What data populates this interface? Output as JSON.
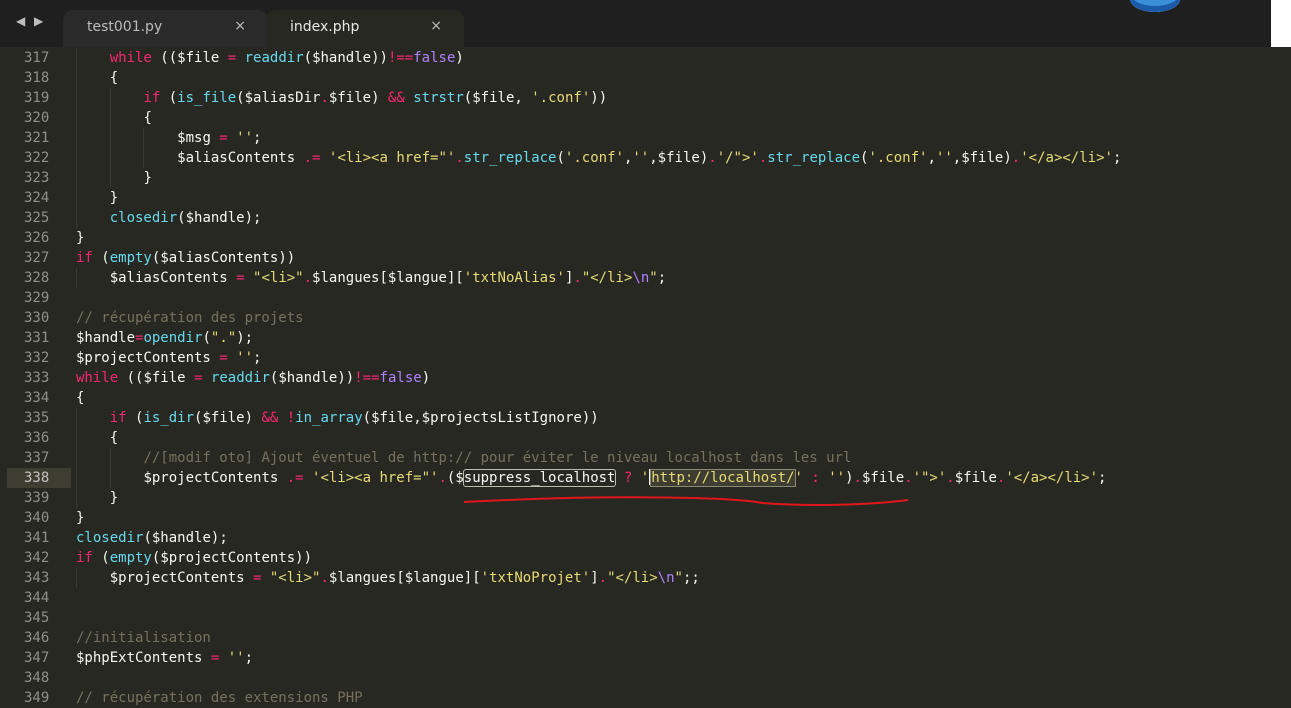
{
  "tabs": [
    {
      "label": "test001.py",
      "close": "×"
    },
    {
      "label": "index.php",
      "close": "×"
    }
  ],
  "nav": {
    "back": "◀",
    "forward": "▶"
  },
  "lines": [
    {
      "n": "317",
      "indent": 1,
      "tokens": [
        [
          "k",
          "while"
        ],
        [
          "v",
          " (("
        ],
        [
          "v",
          "$file"
        ],
        [
          "k",
          " = "
        ],
        [
          "f",
          "readdir"
        ],
        [
          "v",
          "("
        ],
        [
          "v",
          "$handle"
        ],
        [
          "v",
          "))"
        ],
        [
          "k",
          "!=="
        ],
        [
          "p",
          "false"
        ],
        [
          "v",
          ")"
        ]
      ]
    },
    {
      "n": "318",
      "indent": 1,
      "tokens": [
        [
          "v",
          "{"
        ]
      ]
    },
    {
      "n": "319",
      "indent": 2,
      "tokens": [
        [
          "k",
          "if"
        ],
        [
          "v",
          " ("
        ],
        [
          "f",
          "is_file"
        ],
        [
          "v",
          "("
        ],
        [
          "v",
          "$aliasDir"
        ],
        [
          "k",
          "."
        ],
        [
          "v",
          "$file"
        ],
        [
          "v",
          ") "
        ],
        [
          "k",
          "&&"
        ],
        [
          "v",
          " "
        ],
        [
          "f",
          "strstr"
        ],
        [
          "v",
          "("
        ],
        [
          "v",
          "$file"
        ],
        [
          "v",
          ", "
        ],
        [
          "s",
          "'.conf'"
        ],
        [
          "v",
          "))"
        ]
      ]
    },
    {
      "n": "320",
      "indent": 2,
      "tokens": [
        [
          "v",
          "{"
        ]
      ]
    },
    {
      "n": "321",
      "indent": 3,
      "tokens": [
        [
          "v",
          "$msg"
        ],
        [
          "k",
          " = "
        ],
        [
          "s",
          "''"
        ],
        [
          "v",
          ";"
        ]
      ]
    },
    {
      "n": "322",
      "indent": 3,
      "tokens": [
        [
          "v",
          "$aliasContents"
        ],
        [
          "k",
          " .= "
        ],
        [
          "s",
          "'<li><a href=\"'"
        ],
        [
          "k",
          "."
        ],
        [
          "f",
          "str_replace"
        ],
        [
          "v",
          "("
        ],
        [
          "s",
          "'.conf'"
        ],
        [
          "v",
          ","
        ],
        [
          "s",
          "''"
        ],
        [
          "v",
          ","
        ],
        [
          "v",
          "$file"
        ],
        [
          "v",
          ")"
        ],
        [
          "k",
          "."
        ],
        [
          "s",
          "'/\">'"
        ],
        [
          "k",
          "."
        ],
        [
          "f",
          "str_replace"
        ],
        [
          "v",
          "("
        ],
        [
          "s",
          "'.conf'"
        ],
        [
          "v",
          ","
        ],
        [
          "s",
          "''"
        ],
        [
          "v",
          ","
        ],
        [
          "v",
          "$file"
        ],
        [
          "v",
          ")"
        ],
        [
          "k",
          "."
        ],
        [
          "s",
          "'</a></li>'"
        ],
        [
          "v",
          ";"
        ]
      ]
    },
    {
      "n": "323",
      "indent": 2,
      "tokens": [
        [
          "v",
          "}"
        ]
      ]
    },
    {
      "n": "324",
      "indent": 1,
      "tokens": [
        [
          "v",
          "}"
        ]
      ]
    },
    {
      "n": "325",
      "indent": 1,
      "tokens": [
        [
          "f",
          "closedir"
        ],
        [
          "v",
          "("
        ],
        [
          "v",
          "$handle"
        ],
        [
          "v",
          ");"
        ]
      ]
    },
    {
      "n": "326",
      "indent": 0,
      "tokens": [
        [
          "v",
          "}"
        ]
      ]
    },
    {
      "n": "327",
      "indent": 0,
      "tokens": [
        [
          "k",
          "if"
        ],
        [
          "v",
          " ("
        ],
        [
          "f",
          "empty"
        ],
        [
          "v",
          "("
        ],
        [
          "v",
          "$aliasContents"
        ],
        [
          "v",
          "))"
        ]
      ]
    },
    {
      "n": "328",
      "indent": 1,
      "tokens": [
        [
          "v",
          "$aliasContents"
        ],
        [
          "k",
          " = "
        ],
        [
          "s",
          "\"<li>\""
        ],
        [
          "k",
          "."
        ],
        [
          "v",
          "$langues"
        ],
        [
          "v",
          "["
        ],
        [
          "v",
          "$langue"
        ],
        [
          "v",
          "]["
        ],
        [
          "s",
          "'txtNoAlias'"
        ],
        [
          "v",
          "]"
        ],
        [
          "k",
          "."
        ],
        [
          "s",
          "\"</li>"
        ],
        [
          "p",
          "\\n"
        ],
        [
          "s",
          "\""
        ],
        [
          "v",
          ";"
        ]
      ]
    },
    {
      "n": "329",
      "indent": 0,
      "tokens": []
    },
    {
      "n": "330",
      "indent": 0,
      "tokens": [
        [
          "c",
          "// récupération des projets"
        ]
      ]
    },
    {
      "n": "331",
      "indent": 0,
      "tokens": [
        [
          "v",
          "$handle"
        ],
        [
          "k",
          "="
        ],
        [
          "f",
          "opendir"
        ],
        [
          "v",
          "("
        ],
        [
          "s",
          "\".\""
        ],
        [
          "v",
          ");"
        ]
      ]
    },
    {
      "n": "332",
      "indent": 0,
      "tokens": [
        [
          "v",
          "$projectContents"
        ],
        [
          "k",
          " = "
        ],
        [
          "s",
          "''"
        ],
        [
          "v",
          ";"
        ]
      ]
    },
    {
      "n": "333",
      "indent": 0,
      "tokens": [
        [
          "k",
          "while"
        ],
        [
          "v",
          " (("
        ],
        [
          "v",
          "$file"
        ],
        [
          "k",
          " = "
        ],
        [
          "f",
          "readdir"
        ],
        [
          "v",
          "("
        ],
        [
          "v",
          "$handle"
        ],
        [
          "v",
          "))"
        ],
        [
          "k",
          "!=="
        ],
        [
          "p",
          "false"
        ],
        [
          "v",
          ")"
        ]
      ]
    },
    {
      "n": "334",
      "indent": 0,
      "tokens": [
        [
          "v",
          "{"
        ]
      ]
    },
    {
      "n": "335",
      "indent": 1,
      "tokens": [
        [
          "k",
          "if"
        ],
        [
          "v",
          " ("
        ],
        [
          "f",
          "is_dir"
        ],
        [
          "v",
          "("
        ],
        [
          "v",
          "$file"
        ],
        [
          "v",
          ") "
        ],
        [
          "k",
          "&&"
        ],
        [
          "v",
          " "
        ],
        [
          "k",
          "!"
        ],
        [
          "f",
          "in_array"
        ],
        [
          "v",
          "("
        ],
        [
          "v",
          "$file"
        ],
        [
          "v",
          ","
        ],
        [
          "v",
          "$projectsListIgnore"
        ],
        [
          "v",
          "))"
        ]
      ]
    },
    {
      "n": "336",
      "indent": 1,
      "tokens": [
        [
          "v",
          "{"
        ]
      ]
    },
    {
      "n": "337",
      "indent": 2,
      "tokens": [
        [
          "c",
          "//[modif oto] Ajout éventuel de http:// pour éviter le niveau localhost dans les url"
        ]
      ]
    },
    {
      "n": "338",
      "indent": 2,
      "active": true,
      "tokens": [
        [
          "v",
          "$projectContents"
        ],
        [
          "k",
          " .= "
        ],
        [
          "s",
          "'<li><a href=\"'"
        ],
        [
          "k",
          "."
        ],
        [
          "v",
          "("
        ],
        [
          "v",
          "$"
        ],
        [
          "box",
          "suppress_localhost"
        ],
        [
          "k",
          " ? "
        ],
        [
          "s",
          "'"
        ],
        [
          "cursor",
          ""
        ],
        [
          "hl",
          "http://localhost/"
        ],
        [
          "s",
          "'"
        ],
        [
          "k",
          " : "
        ],
        [
          "s",
          "''"
        ],
        [
          "v",
          ")"
        ],
        [
          "k",
          "."
        ],
        [
          "v",
          "$file"
        ],
        [
          "k",
          "."
        ],
        [
          "s",
          "'\">'"
        ],
        [
          "k",
          "."
        ],
        [
          "v",
          "$file"
        ],
        [
          "k",
          "."
        ],
        [
          "s",
          "'</a></li>'"
        ],
        [
          "v",
          ";"
        ]
      ]
    },
    {
      "n": "339",
      "indent": 1,
      "tokens": [
        [
          "v",
          "}"
        ]
      ]
    },
    {
      "n": "340",
      "indent": 0,
      "tokens": [
        [
          "v",
          "}"
        ]
      ]
    },
    {
      "n": "341",
      "indent": 0,
      "tokens": [
        [
          "f",
          "closedir"
        ],
        [
          "v",
          "("
        ],
        [
          "v",
          "$handle"
        ],
        [
          "v",
          ");"
        ]
      ]
    },
    {
      "n": "342",
      "indent": 0,
      "tokens": [
        [
          "k",
          "if"
        ],
        [
          "v",
          " ("
        ],
        [
          "f",
          "empty"
        ],
        [
          "v",
          "("
        ],
        [
          "v",
          "$projectContents"
        ],
        [
          "v",
          "))"
        ]
      ]
    },
    {
      "n": "343",
      "indent": 1,
      "tokens": [
        [
          "v",
          "$projectContents"
        ],
        [
          "k",
          " = "
        ],
        [
          "s",
          "\"<li>\""
        ],
        [
          "k",
          "."
        ],
        [
          "v",
          "$langues"
        ],
        [
          "v",
          "["
        ],
        [
          "v",
          "$langue"
        ],
        [
          "v",
          "]["
        ],
        [
          "s",
          "'txtNoProjet'"
        ],
        [
          "v",
          "]"
        ],
        [
          "k",
          "."
        ],
        [
          "s",
          "\"</li>"
        ],
        [
          "p",
          "\\n"
        ],
        [
          "s",
          "\""
        ],
        [
          "v",
          ";;"
        ]
      ]
    },
    {
      "n": "344",
      "indent": 0,
      "tokens": []
    },
    {
      "n": "345",
      "indent": 0,
      "tokens": []
    },
    {
      "n": "346",
      "indent": 0,
      "tokens": [
        [
          "c",
          "//initialisation"
        ]
      ]
    },
    {
      "n": "347",
      "indent": 0,
      "tokens": [
        [
          "v",
          "$phpExtContents"
        ],
        [
          "k",
          " = "
        ],
        [
          "s",
          "''"
        ],
        [
          "v",
          ";"
        ]
      ]
    },
    {
      "n": "348",
      "indent": 0,
      "tokens": []
    },
    {
      "n": "349",
      "indent": 0,
      "tokens": [
        [
          "c",
          "// récupération des extensions PHP"
        ]
      ]
    }
  ],
  "colors": {
    "background": "#272822",
    "keyword": "#f92672",
    "function": "#66d9ef",
    "string": "#e6db74",
    "comment": "#75715e",
    "constant": "#ae81ff",
    "annotation": "#e0161a"
  }
}
